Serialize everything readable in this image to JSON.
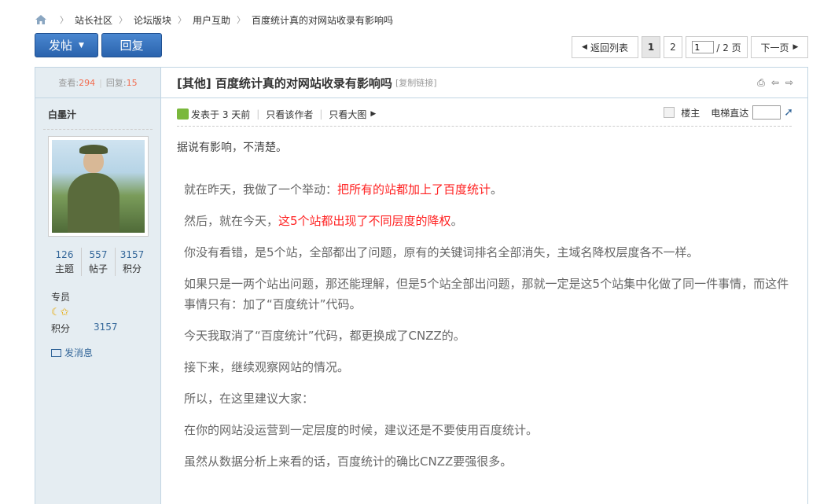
{
  "breadcrumb": [
    "站长社区",
    "论坛版块",
    "用户互助",
    "百度统计真的对网站收录有影响吗"
  ],
  "actions": {
    "post": "发帖",
    "reply": "回复"
  },
  "pager": {
    "back": "返回列表",
    "pages": [
      "1",
      "2"
    ],
    "current_page": "1",
    "total_pages": "/ 2 页",
    "next": "下一页"
  },
  "stats": {
    "views_label": "查看:",
    "views": "294",
    "replies_label": "回复:",
    "replies": "15"
  },
  "thread": {
    "title": "[其他] 百度统计真的对网站收录有影响吗",
    "copy_link": "[复制链接]"
  },
  "author": {
    "name": "白墨汁",
    "counts": [
      {
        "num": "126",
        "label": "主题"
      },
      {
        "num": "557",
        "label": "帖子"
      },
      {
        "num": "3157",
        "label": "积分"
      }
    ],
    "rank": "专员",
    "score_label": "积分",
    "score": "3157",
    "send_msg": "发消息"
  },
  "post": {
    "posted_at": "发表于 3 天前",
    "only_author": "只看该作者",
    "big_image": "只看大图",
    "floor": "楼主",
    "elevator": "电梯直达",
    "intro": "据说有影响，不清楚。",
    "p1_a": "就在昨天，我做了一个举动：",
    "p1_b": "把所有的站都加上了百度统计",
    "p1_c": "。",
    "p2_a": "然后，就在今天，",
    "p2_b": "这5个站都出现了不同层度的降权",
    "p2_c": "。",
    "p3": "你没有看错，是5个站，全部都出了问题，原有的关键词排名全部消失，主域名降权层度各不一样。",
    "p4": "如果只是一两个站出问题，那还能理解，但是5个站全部出问题，那就一定是这5个站集中化做了同一件事情，而这件事情只有：加了“百度统计”代码。",
    "p5": "今天我取消了“百度统计”代码，都更换成了CNZZ的。",
    "p6": "接下来，继续观察网站的情况。",
    "p7": "所以，在这里建议大家：",
    "p8": "在你的网站没运营到一定层度的时候，建议还是不要使用百度统计。",
    "p9": "虽然从数据分析上来看的话，百度统计的确比CNZZ要强很多。"
  }
}
